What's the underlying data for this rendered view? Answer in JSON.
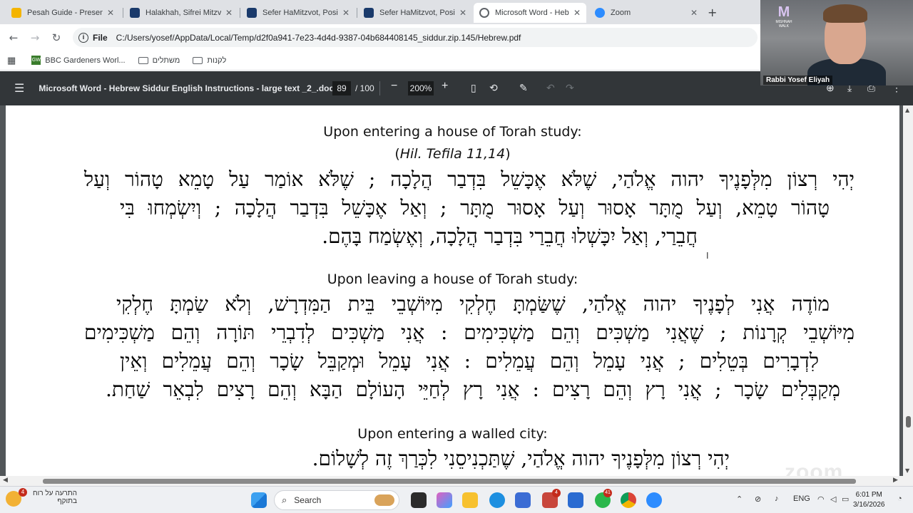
{
  "browser": {
    "tabs": [
      {
        "label": "Pesah Guide - Presentati",
        "active": false
      },
      {
        "label": "Halakhah, Sifrei Mitzvot",
        "active": false
      },
      {
        "label": "Sefer HaMitzvot, Positiv",
        "active": false
      },
      {
        "label": "Sefer HaMitzvot, Positiv",
        "active": false
      },
      {
        "label": "Microsoft Word - Hebre",
        "active": true
      },
      {
        "label": "Zoom",
        "active": false
      }
    ],
    "new_tab": "+",
    "omnibox": {
      "scheme_label": "File",
      "url": "C:/Users/yosef/AppData/Local/Temp/d2f0a941-7e23-4d4d-9387-04b684408145_siddur.zip.145/Hebrew.pdf"
    },
    "bookmarks": [
      {
        "label": "BBC Gardeners Worl...",
        "icon": "gw-favicon"
      },
      {
        "label": "משתלים",
        "icon": "folder-icon"
      },
      {
        "label": "לקנות",
        "icon": "folder-icon"
      }
    ]
  },
  "pdf_viewer": {
    "title": "Microsoft Word - Hebrew Siddur English Instructions - large text _2_.docx",
    "current_page": "89",
    "total_pages": "/ 100",
    "zoom": "200%",
    "zoom_out": "−",
    "zoom_in": "+"
  },
  "document": {
    "sections": [
      {
        "heading": "Upon entering a house of Torah study:",
        "citation_open": "(",
        "citation": "Hil. Tefila 11,14",
        "citation_close": ")",
        "lines": [
          "יְהִי רְצוֹן מִלְּפָנֶיךָ יהוה אֱלֹהַי, שֶׁלֹּא אֶכָּשֵׁל בִּדְבַר הֲלָכָה ; שֶׁלֹּא אוֹמַר עַל טָמֵא טָהוֹר וְעַל",
          "טָהוֹר טָמֵא, וְעַל מֻתָּר אָסוּר וְעַל אָסוּר מֻתָּר ; וְאַל אֶכָּשֵׁל בִּדְבַר הֲלָכָה ; וְיִשְׂמְחוּ בִּי",
          "חֲבֵרַי, וְאַל יִכָּשְׁלוּ חֲבֵרַי בִּדְבַר הֲלָכָה, וְאֶשְׂמַח בָּהֶם."
        ]
      },
      {
        "heading": "Upon leaving a house of Torah study:",
        "lines": [
          "מוֹדֶה אֲנִי לְפָנֶיךָ יהוה אֱלֹהַי, שֶׁשַּׂמְתָּ חֶלְקִי מִיּוֹשְׁבֵי בֵּית הַמִּדְרָשׁ, וְלֹא שַׂמְתָּ חֶלְקִי",
          "מִיּוֹשְׁבֵי קְרָנוֹת ; שֶׁאֲנִי מַשְׁכִּים וְהֵם מַשְׁכִּימִים : אֲנִי מַשְׁכִּים לְדִבְרֵי תּוֹרָה וְהֵם מַשְׁכִּימִים",
          "לִדְבָרִים בְּטֵלִים ; אֲנִי עָמֵל וְהֵם עֲמֵלִים : אֲנִי עָמֵל וּמְקַבֵּל שָׂכָר וְהֵם עֲמֵלִים וְאֵין",
          "מְקַבְּלִים שָׂכָר ; אֲנִי רָץ וְהֵם רָצִים : אֲנִי רָץ לְחַיֵּי הָעוֹלָם הַבָּא וְהֵם רָצִים לִבְאֵר שַׁחַת."
        ]
      },
      {
        "heading": "Upon entering a walled city:",
        "lines": [
          "יְהִי רְצוֹן מִלְּפָנֶיךָ יהוה אֱלֹהַי, שֶׁתַּכְנִיסֵנִי לִכְּרַךְ זֶה לְשָׁלוֹם."
        ]
      }
    ]
  },
  "webcam": {
    "participant_name": "Rabbi Yosef Eliyah",
    "logo_text": "MISHNAH WALK"
  },
  "taskbar": {
    "weather_line1": "התרעה על רוח",
    "weather_line2": "בתוקף",
    "weather_badge": "4",
    "search_label": "Search",
    "badge_store": "4",
    "badge_whatsapp": "41",
    "language": "ENG",
    "time": "6:01 PM",
    "date": "3/16/2026"
  },
  "watermark": "zoom",
  "colors": {
    "pdf_toolbar": "#323639",
    "pdf_background": "#525659",
    "tab_strip": "#dfe1e5"
  }
}
